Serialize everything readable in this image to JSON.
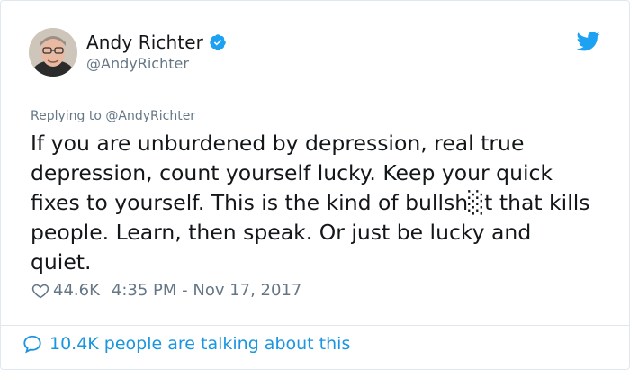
{
  "author": {
    "display_name": "Andy Richter",
    "handle": "@AndyRichter",
    "verified": true
  },
  "tweet": {
    "replying_label": "Replying to",
    "replying_to": "@AndyRichter",
    "text": "If you are unburdened by depression, real true\ndepression, count yourself lucky.  Keep your quick\nfixes to yourself.  This is the kind of bullsh░t that kills\npeople. Learn, then speak. Or just be lucky and\nquiet.",
    "likes": "44.6K",
    "timestamp": "4:35 PM - Nov 17, 2017"
  },
  "footer": {
    "conversation": "10.4K people are talking about this"
  },
  "icons": {
    "verified": "verified-badge-icon",
    "brand": "twitter-bird-icon",
    "like": "heart-icon",
    "reply": "speech-bubble-icon"
  },
  "colors": {
    "brand_blue": "#1da1f2",
    "link_blue": "#1b95e0",
    "muted": "#657786",
    "text": "#14171a"
  }
}
